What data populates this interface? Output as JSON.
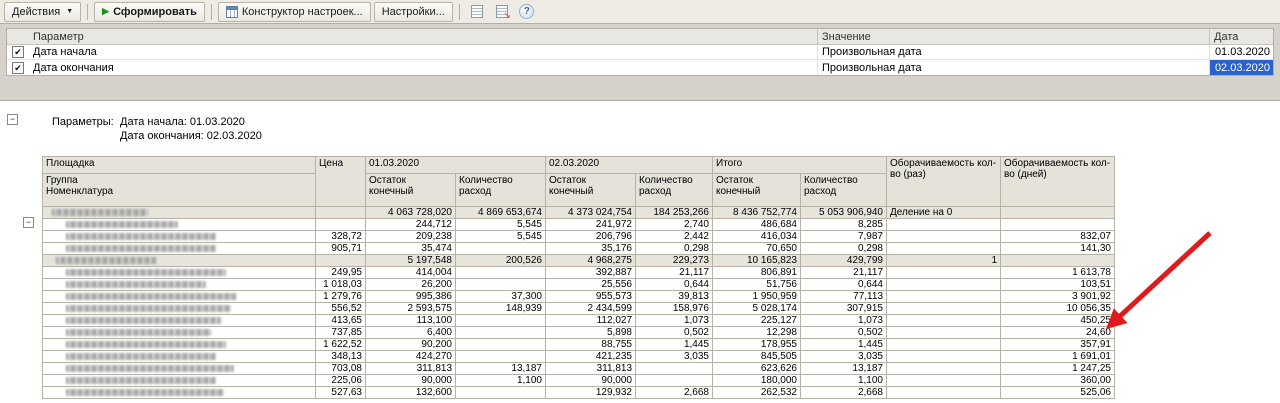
{
  "colors": {
    "selection": "#2a62c9",
    "arrow": "#e01a1a",
    "header_bg": "#e5e2da",
    "group_bg": "#e7e4dc",
    "toolbar_bg": "#eeebe4",
    "window_bg": "#d5d2cb"
  },
  "toolbar": {
    "actions_label": "Действия",
    "generate_label": "Сформировать",
    "constructor_label": "Конструктор настроек...",
    "settings_label": "Настройки...",
    "help_label": "?"
  },
  "param_grid": {
    "col_param": "Параметр",
    "col_value": "Значение",
    "col_date": "Дата",
    "rows": [
      {
        "checked": true,
        "param": "Дата начала",
        "value": "Произвольная дата",
        "date": "01.03.2020",
        "selected": false
      },
      {
        "checked": true,
        "param": "Дата окончания",
        "value": "Произвольная дата",
        "date": "02.03.2020",
        "selected": true
      }
    ]
  },
  "report": {
    "params_title": "Параметры:",
    "param_line1": "Дата начала: 01.03.2020",
    "param_line2": "Дата окончания: 02.03.2020",
    "head": {
      "area": "Площадка",
      "group": "Группа",
      "nomenclature": "Номенклатура",
      "price": "Цена",
      "date1": "01.03.2020",
      "date2": "02.03.2020",
      "total": "Итого",
      "rest": "Остаток конечный",
      "expense": "Количество расход",
      "turn_times": "Оборачиваемость кол-во (раз)",
      "turn_days": "Оборачиваемость кол-во (дней)"
    },
    "rows": [
      {
        "type": "group1",
        "blur_w": 96,
        "cells": [
          "",
          "4 063 728,020",
          "4 869 653,674",
          "4 373 024,754",
          "184 253,266",
          "8 436 752,774",
          "5 053 906,940",
          "Деление на 0",
          ""
        ]
      },
      {
        "type": "item",
        "blur_w": 112,
        "cells": [
          "",
          "244,712",
          "5,545",
          "241,972",
          "2,740",
          "486,684",
          "8,285",
          "",
          ""
        ]
      },
      {
        "type": "item",
        "blur_w": 150,
        "cells": [
          "328,72",
          "209,238",
          "5,545",
          "206,796",
          "2,442",
          "416,034",
          "7,987",
          "",
          "832,07"
        ]
      },
      {
        "type": "item",
        "blur_w": 150,
        "cells": [
          "905,71",
          "35,474",
          "",
          "35,176",
          "0,298",
          "70,650",
          "0,298",
          "",
          "141,30"
        ]
      },
      {
        "type": "group2",
        "blur_w": 100,
        "cells": [
          "",
          "5 197,548",
          "200,526",
          "4 968,275",
          "229,273",
          "10 165,823",
          "429,799",
          "1",
          ""
        ]
      },
      {
        "type": "item",
        "blur_w": 160,
        "cells": [
          "249,95",
          "414,004",
          "",
          "392,887",
          "21,117",
          "806,891",
          "21,117",
          "",
          "1 613,78"
        ]
      },
      {
        "type": "item",
        "blur_w": 140,
        "cells": [
          "1 018,03",
          "26,200",
          "",
          "25,556",
          "0,644",
          "51,756",
          "0,644",
          "",
          "103,51"
        ]
      },
      {
        "type": "item",
        "blur_w": 170,
        "cells": [
          "1 279,76",
          "995,386",
          "37,300",
          "955,573",
          "39,813",
          "1 950,959",
          "77,113",
          "",
          "3 901,92"
        ]
      },
      {
        "type": "item",
        "blur_w": 165,
        "cells": [
          "556,52",
          "2 593,575",
          "148,939",
          "2 434,599",
          "158,976",
          "5 028,174",
          "307,915",
          "",
          "10 056,35"
        ]
      },
      {
        "type": "item",
        "blur_w": 155,
        "cells": [
          "413,65",
          "113,100",
          "",
          "112,027",
          "1,073",
          "225,127",
          "1,073",
          "",
          "450,25"
        ]
      },
      {
        "type": "item",
        "blur_w": 145,
        "cells": [
          "737,85",
          "6,400",
          "",
          "5,898",
          "0,502",
          "12,298",
          "0,502",
          "",
          "24,60"
        ]
      },
      {
        "type": "item",
        "blur_w": 160,
        "cells": [
          "1 622,52",
          "90,200",
          "",
          "88,755",
          "1,445",
          "178,955",
          "1,445",
          "",
          "357,91"
        ]
      },
      {
        "type": "item",
        "blur_w": 150,
        "cells": [
          "348,13",
          "424,270",
          "",
          "421,235",
          "3,035",
          "845,505",
          "3,035",
          "",
          "1 691,01"
        ]
      },
      {
        "type": "item",
        "blur_w": 168,
        "cells": [
          "703,08",
          "311,813",
          "13,187",
          "311,813",
          "",
          "623,626",
          "13,187",
          "",
          "1 247,25"
        ]
      },
      {
        "type": "item",
        "blur_w": 150,
        "cells": [
          "225,06",
          "90,000",
          "1,100",
          "90,000",
          "",
          "180,000",
          "1,100",
          "",
          "360,00"
        ]
      },
      {
        "type": "item",
        "blur_w": 158,
        "cells": [
          "527,63",
          "132,600",
          "",
          "129,932",
          "2,668",
          "262,532",
          "2,668",
          "",
          "525,06"
        ]
      }
    ]
  }
}
